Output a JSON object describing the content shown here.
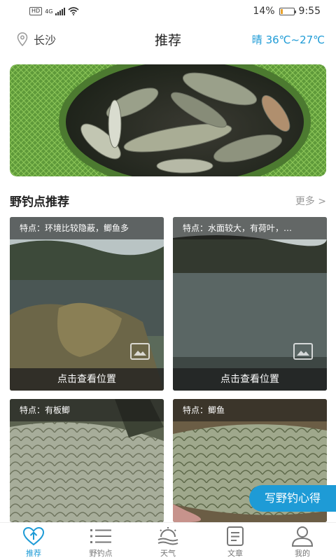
{
  "status_bar": {
    "hd": "HD",
    "network": "4G",
    "battery_percent": "14%",
    "battery_level": 0.14,
    "time": "9:55"
  },
  "header": {
    "location": "长沙",
    "title": "推荐",
    "weather": "晴  36℃~27℃"
  },
  "section": {
    "title": "野钓点推荐",
    "more": "更多 >"
  },
  "cards": [
    {
      "feature": "特点：环境比较隐蔽，鲫鱼多",
      "locate": "点击查看位置"
    },
    {
      "feature": "特点：水面较大，有荷叶，…",
      "locate": "点击查看位置"
    },
    {
      "feature": "特点：有板鲫"
    },
    {
      "feature": "特点：鲫鱼"
    }
  ],
  "fab": {
    "label": "写野钓心得"
  },
  "tabbar": {
    "items": [
      {
        "label": "推荐",
        "icon": "heart-arrow-icon",
        "active": true
      },
      {
        "label": "野钓点",
        "icon": "list-icon",
        "active": false
      },
      {
        "label": "天气",
        "icon": "weather-icon",
        "active": false
      },
      {
        "label": "文章",
        "icon": "article-icon",
        "active": false
      },
      {
        "label": "我的",
        "icon": "user-icon",
        "active": false
      }
    ]
  },
  "colors": {
    "accent": "#1e9bd6",
    "tab_inactive": "#777777",
    "more": "#999999"
  }
}
